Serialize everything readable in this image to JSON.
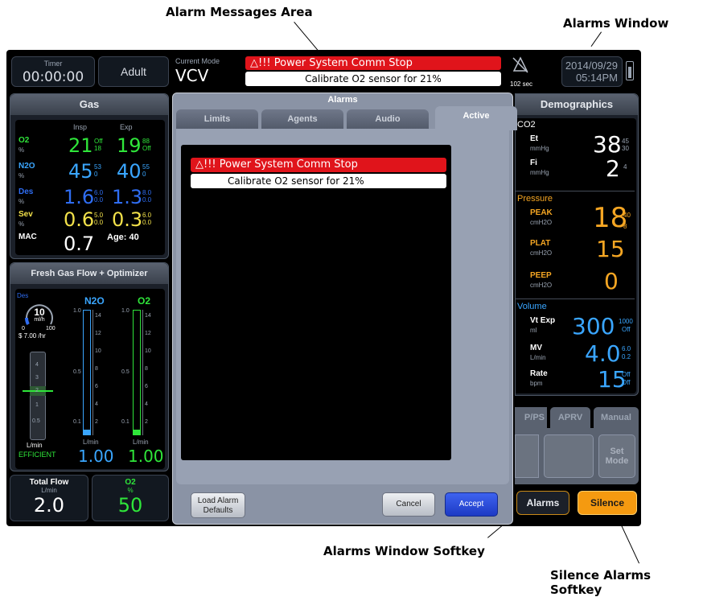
{
  "callouts": {
    "alarm_messages_area": "Alarm Messages Area",
    "alarms_window": "Alarms Window",
    "alarms_window_softkey": "Alarms Window Softkey",
    "silence_alarms_softkey": "Silence Alarms Softkey"
  },
  "header": {
    "timer_label": "Timer",
    "timer_value": "00:00:00",
    "patient_type": "Adult",
    "current_mode_label": "Current Mode",
    "current_mode": "VCV",
    "alarm_primary": "△!!! Power System Comm Stop",
    "alarm_secondary": "Calibrate O2 sensor for 21%",
    "silence_time": "102 sec",
    "date": "2014/09/29",
    "time": "05:14PM"
  },
  "gas_panel": {
    "title": "Gas",
    "col_insp": "Insp",
    "col_exp": "Exp",
    "rows": [
      {
        "name": "O2",
        "unit": "%",
        "insp": "21",
        "insp_hi": "Off",
        "insp_lo": "18",
        "exp": "19",
        "exp_hi": "88",
        "exp_lo": "Off",
        "color": "#2fe63a"
      },
      {
        "name": "N2O",
        "unit": "%",
        "insp": "45",
        "insp_hi": "53",
        "insp_lo": "0",
        "exp": "40",
        "exp_hi": "55",
        "exp_lo": "0",
        "color": "#3aa6ff"
      },
      {
        "name": "Des",
        "unit": "%",
        "insp": "1.6",
        "insp_hi": "6.0",
        "insp_lo": "0.0",
        "exp": "1.3",
        "exp_hi": "8.0",
        "exp_lo": "0.0",
        "color": "#2f6df2"
      },
      {
        "name": "Sev",
        "unit": "%",
        "insp": "0.6",
        "insp_hi": "5.0",
        "insp_lo": "0.0",
        "exp": "0.3",
        "exp_hi": "6.0",
        "exp_lo": "0.0",
        "color": "#f2e14a"
      }
    ],
    "mac_label": "MAC",
    "mac_value": "0.7",
    "age_label": "Age: 40"
  },
  "fresh_gas": {
    "title": "Fresh Gas Flow + Optimizer",
    "agent": "Des",
    "dial_value": "10",
    "dial_unit": "ml/h",
    "dial_min": "0",
    "dial_max": "100",
    "cost": "$ 7.00 /hr",
    "optimizer_ticks": [
      "4",
      "3",
      "2",
      "1",
      "0.5"
    ],
    "optimizer_unit": "L/min",
    "optimizer_status": "EFFICIENT",
    "n2o_label": "N2O",
    "o2_label": "O2",
    "left_ticks": [
      "1.0",
      "0.5",
      "0.1"
    ],
    "right_ticks": [
      "14",
      "12",
      "10",
      "8",
      "6",
      "4",
      "2"
    ],
    "flow_unit": "L/min",
    "n2o_value": "1.00",
    "o2_value": "1.00",
    "n2o_level": 0.04,
    "o2_level": 0.04
  },
  "bottom_left": {
    "total_flow_label": "Total Flow",
    "total_flow_unit": "L/min",
    "total_flow_value": "2.0",
    "o2_label": "O2",
    "o2_unit": "%",
    "o2_value": "50"
  },
  "alarms_window": {
    "title": "Alarms",
    "tabs": [
      "Limits",
      "Agents",
      "Audio",
      "Active"
    ],
    "active_alarm_1": "△!!! Power System Comm Stop",
    "active_alarm_2": "Calibrate O2 sensor for 21%",
    "load_defaults_line1": "Load Alarm",
    "load_defaults_line2": "Defaults",
    "cancel": "Cancel",
    "accept": "Accept"
  },
  "right_panel": {
    "title": "Demographics",
    "co2_label": "CO2",
    "et_label": "Et",
    "et_unit": "mmHg",
    "et_value": "38",
    "et_hi": "45",
    "et_lo": "30",
    "fi_label": "Fi",
    "fi_unit": "mmHg",
    "fi_value": "2",
    "fi_hi": "4",
    "pressure_label": "Pressure",
    "peak_label": "PEAK",
    "peak_unit": "cmH2O",
    "peak_value": "18",
    "peak_hi": "40",
    "peak_lo": "8",
    "plat_label": "PLAT",
    "plat_unit": "cmH2O",
    "plat_value": "15",
    "peep_label": "PEEP",
    "peep_unit": "cmH2O",
    "peep_value": "0",
    "volume_label": "Volume",
    "vt_label": "Vt Exp",
    "vt_unit": "ml",
    "vt_value": "300",
    "vt_hi": "1000",
    "vt_lo": "Off",
    "mv_label": "MV",
    "mv_unit": "L/min",
    "mv_value": "4.0",
    "mv_hi": "6.0",
    "mv_lo": "0.2",
    "rate_label": "Rate",
    "rate_unit": "bpm",
    "rate_value": "15",
    "rate_hi": "Off",
    "rate_lo": "Off",
    "mode_tabs": [
      "P/PS",
      "APRV",
      "Manual"
    ],
    "set_mode_line1": "Set",
    "set_mode_line2": "Mode",
    "alarms_key": "Alarms",
    "silence_key": "Silence"
  },
  "colors": {
    "alarm_red": "#e0141b",
    "pressure_orange": "#f5a623",
    "volume_blue": "#3aa6ff",
    "silence_orange": "#f59a10",
    "accept_blue": "#2a4be0"
  }
}
